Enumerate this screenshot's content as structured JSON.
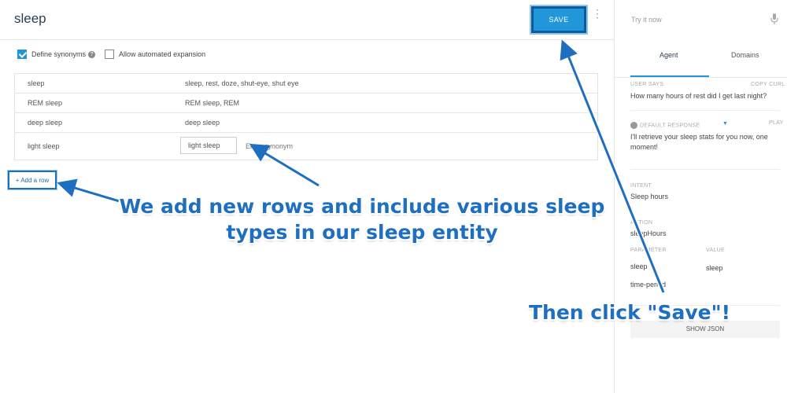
{
  "header": {
    "title": "sleep",
    "save_label": "SAVE"
  },
  "options": {
    "define_synonyms": "Define synonyms",
    "define_synonyms_checked": true,
    "allow_expansion": "Allow automated expansion",
    "allow_expansion_checked": false
  },
  "table": {
    "rows": [
      {
        "value": "sleep",
        "synonyms": "sleep, rest, doze, shut-eye, shut eye"
      },
      {
        "value": "REM sleep",
        "synonyms": "REM sleep, REM"
      },
      {
        "value": "deep sleep",
        "synonyms": "deep sleep"
      }
    ],
    "new_row": {
      "value": "light sleep",
      "chip": "light sleep",
      "placeholder": "Enter synonym"
    }
  },
  "add_row_label": "+ Add a row",
  "panel": {
    "try_it": "Try it now",
    "tabs": [
      "Agent",
      "Domains"
    ],
    "user_says_label": "USER SAYS",
    "copy_curl": "COPY CURL",
    "user_says": "How many hours of rest did I get last night?",
    "default_response_label": "DEFAULT RESPONSE",
    "play": "PLAY",
    "response": "I'll retrieve your sleep stats for you now, one moment!",
    "intent_label": "INTENT",
    "intent": "Sleep hours",
    "action_label": "ACTION",
    "action": "sleepHours",
    "parameter_label": "PARAMETER",
    "value_label": "VALUE",
    "params": [
      {
        "name": "sleep",
        "value": "sleep"
      },
      {
        "name": "time-period",
        "value": ""
      }
    ],
    "show_json": "SHOW JSON"
  },
  "annotations": {
    "rows_note": "We add new rows and include various sleep types in our sleep entity",
    "save_note": "Then click \"Save\"!",
    "color": "#1f6fc0"
  },
  "colors": {
    "accent": "#2196d8",
    "outline": "#0d5b9b"
  },
  "icons": [
    "kebab-menu-icon",
    "microphone-icon",
    "help-icon",
    "checkbox-icon",
    "gear-icon",
    "chevron-down-icon"
  ]
}
